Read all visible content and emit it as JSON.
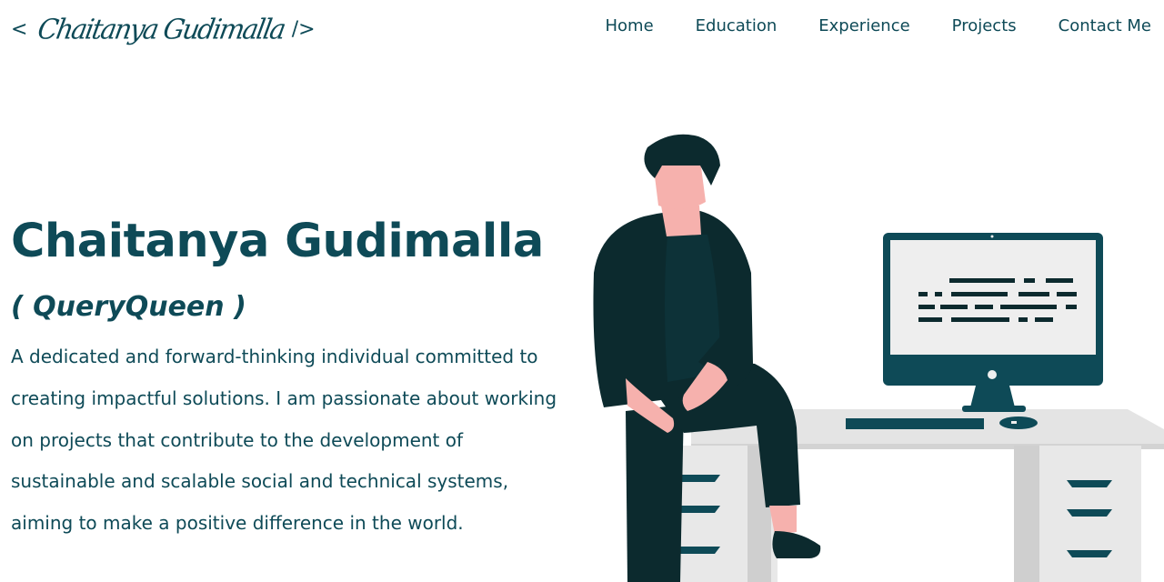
{
  "header": {
    "logo": {
      "open": "<",
      "name": "Chaitanya Gudimalla",
      "close": "/>"
    },
    "nav": [
      {
        "label": "Home"
      },
      {
        "label": "Education"
      },
      {
        "label": "Experience"
      },
      {
        "label": "Projects"
      },
      {
        "label": "Contact Me"
      }
    ]
  },
  "hero": {
    "name": "Chaitanya Gudimalla",
    "nickname": "( QueryQueen )",
    "bio": "A dedicated and forward-thinking individual committed to creating impactful solutions. I am passionate about working on projects that contribute to the development of sustainable and scalable social and technical systems, aiming to make a positive difference in the world."
  },
  "colors": {
    "primary": "#0e4a57",
    "figure_dark": "#0c2a2e",
    "skin": "#f6b1ad",
    "desk": "#e4e4e4",
    "screen": "#eeeeee"
  },
  "icons": {
    "illustration": "developer-at-desk-illustration"
  }
}
